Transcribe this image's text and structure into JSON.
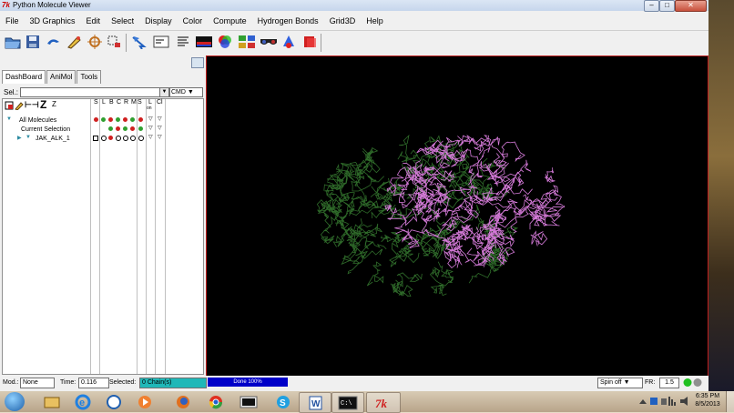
{
  "window": {
    "title": "Python Molecule Viewer",
    "icon": "pmv-logo-icon",
    "controls": [
      "minimize",
      "maximize",
      "close"
    ]
  },
  "menu": [
    "File",
    "3D Graphics",
    "Edit",
    "Select",
    "Display",
    "Color",
    "Compute",
    "Hydrogen Bonds",
    "Grid3D",
    "Help"
  ],
  "toolbar": {
    "icons": [
      "open-folder-icon",
      "save-icon",
      "undo-icon",
      "pencil-icon",
      "center-icon",
      "select-icon",
      "pick-icon",
      "console-icon",
      "text-editor-icon",
      "spectrum-icon",
      "color-by-icon",
      "molecule-tree-icon",
      "stereo-glasses-icon",
      "query-icon",
      "layers-icon"
    ]
  },
  "dashboard": {
    "tabs": [
      "DashBoard",
      "AniMol",
      "Tools"
    ],
    "active_tab": "DashBoard",
    "sel_label": "Sel.:",
    "sel_value": "",
    "cmd_value": "CMD",
    "header_symbol": "Z",
    "header_symbol2": "Z",
    "columns": [
      "S",
      "L",
      "B",
      "C",
      "R",
      "M",
      "S",
      "L",
      "Cl"
    ],
    "sub_labels": [
      "on",
      ""
    ],
    "tree": [
      {
        "label": "All Molecules"
      },
      {
        "label": "Current Selection"
      },
      {
        "label": "JAK_ALK_1"
      }
    ]
  },
  "viewer": {
    "background": "#000000",
    "frame_color": "#c02020",
    "molecule_colors": [
      "#2f6b2a",
      "#d47ad8"
    ]
  },
  "status": {
    "mod_label": "Mod.:",
    "mod_value": "None",
    "time_label": "Time:",
    "time_value": "0.116",
    "selected_label": "Selected:",
    "selected_value": "0 Chain(s)",
    "progress_text": "Done 100%",
    "progress_value": 1.0,
    "spin_value": "Spin off",
    "fr_label": "FR:",
    "fr_value": "1.5"
  },
  "taskbar": {
    "apps": [
      "windows-explorer",
      "internet-explorer",
      "dell-icon",
      "media-player",
      "firefox",
      "chrome",
      "terminal-icon",
      "skype",
      "word-icon",
      "cmd-icon",
      "pmv-icon"
    ],
    "clock_time": "6:35 PM",
    "clock_date": "8/5/2013"
  }
}
